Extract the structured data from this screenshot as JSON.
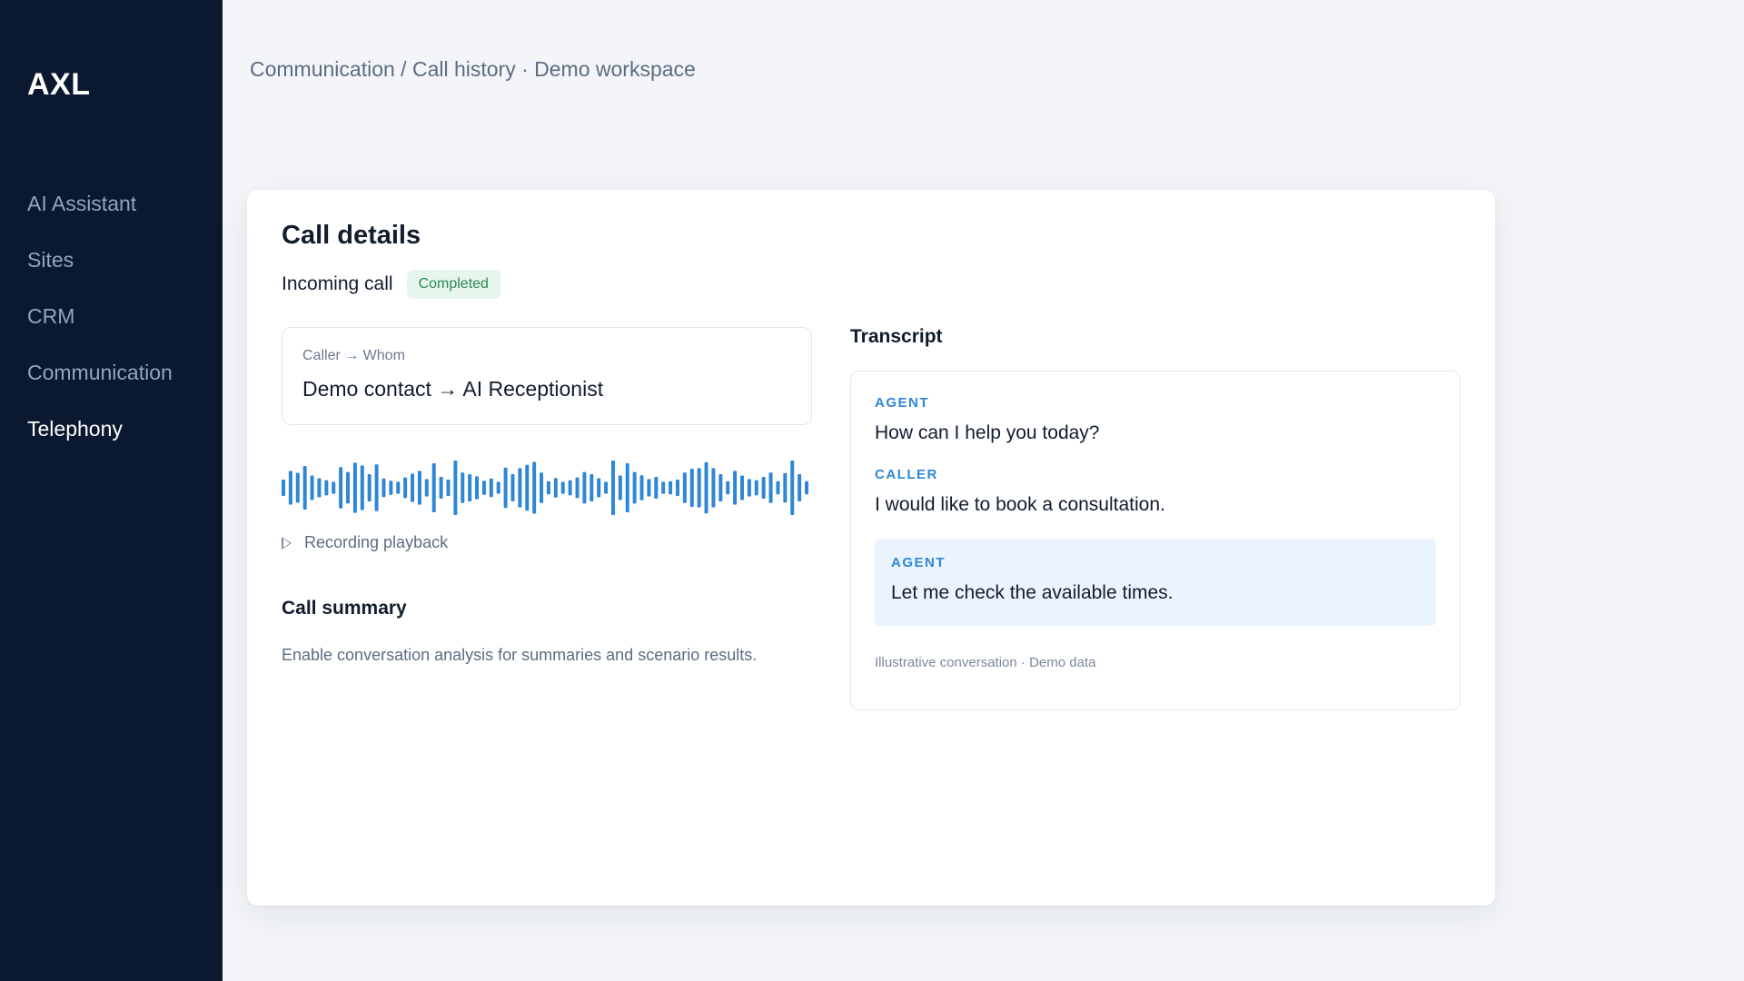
{
  "sidebar": {
    "logo": "AXL",
    "items": [
      {
        "label": "AI Assistant"
      },
      {
        "label": "Sites"
      },
      {
        "label": "CRM"
      },
      {
        "label": "Communication"
      },
      {
        "label": "Telephony",
        "active": true
      }
    ]
  },
  "breadcrumb": "Communication / Call history · Demo workspace",
  "call": {
    "title": "Call details",
    "type": "Incoming call",
    "status": "Completed",
    "party_label": "Caller → Whom",
    "party_value": "Demo contact → AI Receptionist",
    "playback_label": "Recording playback",
    "summary_title": "Call summary",
    "summary_text": "Enable conversation analysis for summaries and scenario results."
  },
  "transcript": {
    "title": "Transcript",
    "messages": [
      {
        "role": "AGENT",
        "text": "How can I help you today?"
      },
      {
        "role": "CALLER",
        "text": "I would like to book a consultation."
      },
      {
        "role": "AGENT",
        "text": "Let me check the available times."
      }
    ],
    "note": "Illustrative conversation · Demo data"
  },
  "colors": {
    "sidebar_bg": "#0b1930",
    "accent": "#2f86d6",
    "status_bg": "#e6f6ec",
    "status_text": "#2a8a53",
    "highlight_bg": "#ebf4fe"
  },
  "waveform_levels": [
    0.3,
    0.62,
    0.55,
    0.8,
    0.45,
    0.35,
    0.28,
    0.22,
    0.76,
    0.58,
    0.92,
    0.82,
    0.5,
    0.86,
    0.34,
    0.26,
    0.22,
    0.38,
    0.52,
    0.62,
    0.32,
    0.9,
    0.4,
    0.3,
    1.0,
    0.56,
    0.5,
    0.42,
    0.26,
    0.34,
    0.22,
    0.74,
    0.5,
    0.72,
    0.84,
    0.95,
    0.56,
    0.24,
    0.36,
    0.22,
    0.28,
    0.38,
    0.58,
    0.5,
    0.35,
    0.22,
    1.0,
    0.45,
    0.9,
    0.58,
    0.46,
    0.32,
    0.4,
    0.22,
    0.24,
    0.3,
    0.56,
    0.7,
    0.72,
    0.94,
    0.72,
    0.5,
    0.24,
    0.62,
    0.45,
    0.32,
    0.28,
    0.4,
    0.56,
    0.24,
    0.54,
    1.0,
    0.5,
    0.24
  ]
}
